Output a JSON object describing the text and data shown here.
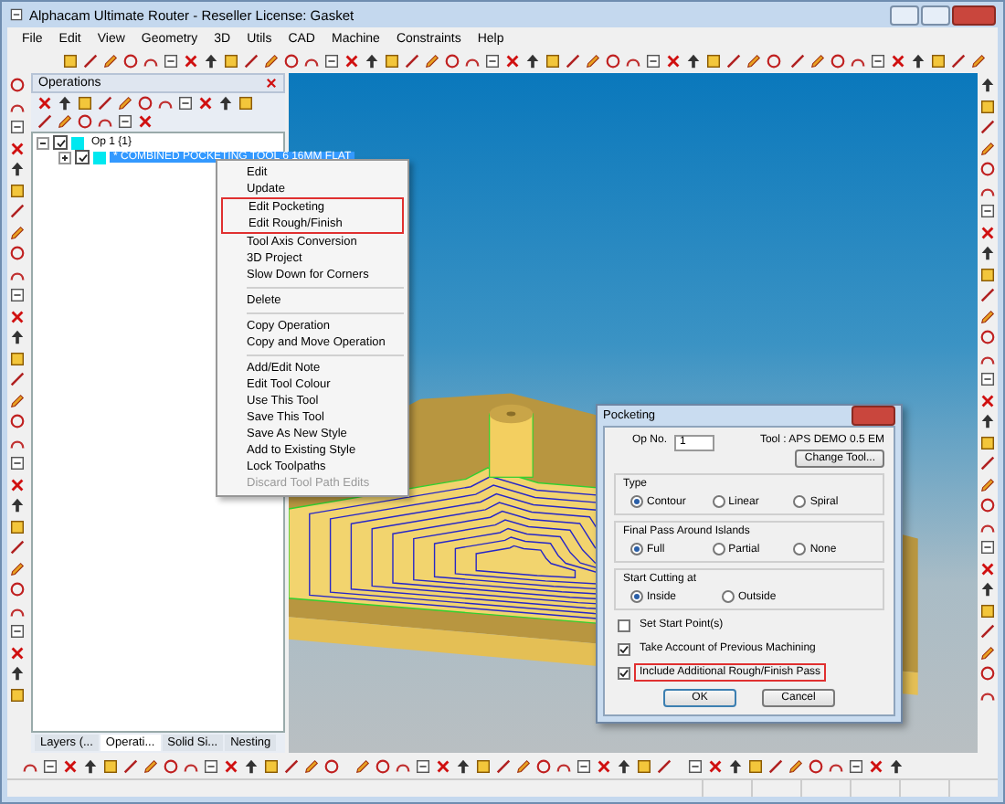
{
  "window": {
    "title": "Alphacam Ultimate Router - Reseller License: Gasket"
  },
  "menu": [
    "File",
    "Edit",
    "View",
    "Geometry",
    "3D",
    "Utils",
    "CAD",
    "Machine",
    "Constraints",
    "Help"
  ],
  "operations_panel": {
    "title": "Operations",
    "tree": [
      {
        "label": "Op 1  {1}",
        "checked": true,
        "expanded": true,
        "selected": false,
        "children": [
          {
            "label": "* COMBINED POCKETING   TOOL 6   16MM FLAT",
            "checked": true,
            "expanded": false,
            "selected": true
          }
        ]
      }
    ],
    "tabs": [
      {
        "label": "Layers (...",
        "selected": false
      },
      {
        "label": "Operati...",
        "selected": true
      },
      {
        "label": "Solid Si...",
        "selected": false
      },
      {
        "label": "Nesting",
        "selected": false
      }
    ]
  },
  "context_menu": {
    "items": [
      {
        "kind": "item",
        "label": "Edit",
        "disabled": false,
        "outlined": false
      },
      {
        "kind": "item",
        "label": "Update",
        "disabled": false,
        "outlined": false
      },
      {
        "kind": "item",
        "label": "Edit Pocketing",
        "disabled": false,
        "outlined": true
      },
      {
        "kind": "item",
        "label": "Edit Rough/Finish",
        "disabled": false,
        "outlined": true
      },
      {
        "kind": "item",
        "label": "Tool Axis Conversion",
        "disabled": false,
        "outlined": false
      },
      {
        "kind": "item",
        "label": "3D Project",
        "disabled": false,
        "outlined": false
      },
      {
        "kind": "item",
        "label": "Slow Down for Corners",
        "disabled": false,
        "outlined": false
      },
      {
        "kind": "separator"
      },
      {
        "kind": "item",
        "label": "Delete",
        "disabled": false,
        "outlined": false
      },
      {
        "kind": "separator"
      },
      {
        "kind": "item",
        "label": "Copy Operation",
        "disabled": false,
        "outlined": false
      },
      {
        "kind": "item",
        "label": "Copy and Move Operation",
        "disabled": false,
        "outlined": false
      },
      {
        "kind": "separator"
      },
      {
        "kind": "item",
        "label": "Add/Edit Note",
        "disabled": false,
        "outlined": false
      },
      {
        "kind": "item",
        "label": "Edit Tool Colour",
        "disabled": false,
        "outlined": false
      },
      {
        "kind": "item",
        "label": "Use This Tool",
        "disabled": false,
        "outlined": false
      },
      {
        "kind": "item",
        "label": "Save This Tool",
        "disabled": false,
        "outlined": false
      },
      {
        "kind": "item",
        "label": "Save As New Style",
        "disabled": false,
        "outlined": false
      },
      {
        "kind": "item",
        "label": "Add to Existing Style",
        "disabled": false,
        "outlined": false
      },
      {
        "kind": "item",
        "label": "Lock Toolpaths",
        "disabled": false,
        "outlined": false
      },
      {
        "kind": "item",
        "label": "Discard Tool Path Edits",
        "disabled": true,
        "outlined": false
      }
    ]
  },
  "dialog": {
    "title": "Pocketing",
    "op_no_label": "Op No.",
    "op_no_value": "1",
    "tool_label": "Tool : APS DEMO 0.5 EM",
    "change_tool_button": "Change Tool...",
    "groups": [
      {
        "title": "Type",
        "options": [
          {
            "label": "Contour",
            "selected": true
          },
          {
            "label": "Linear",
            "selected": false
          },
          {
            "label": "Spiral",
            "selected": false
          }
        ]
      },
      {
        "title": "Final Pass Around Islands",
        "options": [
          {
            "label": "Full",
            "selected": true
          },
          {
            "label": "Partial",
            "selected": false
          },
          {
            "label": "None",
            "selected": false
          }
        ]
      },
      {
        "title": "Start Cutting at",
        "options": [
          {
            "label": "Inside",
            "selected": true
          },
          {
            "label": "Outside",
            "selected": false
          }
        ]
      }
    ],
    "checkboxes": [
      {
        "label": "Set Start Point(s)",
        "checked": false,
        "outlined": false
      },
      {
        "label": "Take Account of Previous Machining",
        "checked": true,
        "outlined": false
      },
      {
        "label": "Include Additional Rough/Finish Pass",
        "checked": true,
        "outlined": true
      }
    ],
    "buttons": [
      "OK",
      "Cancel"
    ]
  }
}
